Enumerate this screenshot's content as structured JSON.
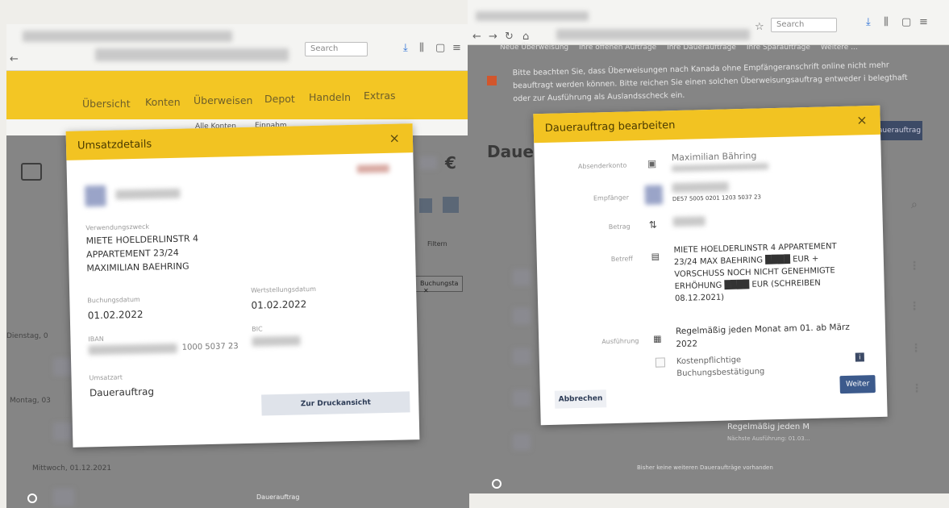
{
  "left": {
    "browser": {
      "search_placeholder": "Search"
    },
    "nav_items": [
      "Übersicht",
      "Konten",
      "Überweisen",
      "Depot",
      "Handeln",
      "Extras"
    ],
    "sub_nav": [
      "Alle Konten",
      "Einnahm"
    ],
    "euro_sign": "€",
    "row_labels": [
      "Dienstag, 0",
      "Montag, 03",
      "Mittwoch, 01.12.2021"
    ],
    "filter_tag": "Buchungsta",
    "filter_close": "✕",
    "umsatz_filter": "Filtern",
    "bottom_text": "Dauerauftrag",
    "modal": {
      "title": "Umsatzdetails",
      "close": "×",
      "verwendungszweck_label": "Verwendungszweck",
      "verwendungszweck_lines": [
        "MIETE HOELDERLINSTR 4",
        "APPARTEMENT 23/24",
        "MAXIMILIAN BAEHRING"
      ],
      "buchungsdatum_label": "Buchungsdatum",
      "buchungsdatum": "01.02.2022",
      "wertstellung_label": "Wertstellungsdatum",
      "wertstellung": "01.02.2022",
      "iban_label": "IBAN",
      "iban_tail": "1000 5037 23",
      "bic_label": "BIC",
      "umsatzart_label": "Umsatzart",
      "umsatzart": "Dauerauftrag",
      "print_button": "Zur Druckansicht"
    }
  },
  "right": {
    "browser": {
      "search_placeholder": "Search"
    },
    "top_links": [
      "Neue Überweisung",
      "Ihre offenen Aufträge",
      "Ihre Daueraufträge",
      "Ihre Sparaufträge",
      "Weitere ..."
    ],
    "notice": "Bitte beachten Sie, dass Überweisungen nach Kanada ohne Empfängeranschrift online nicht mehr beauftragt werden können. Bitte reichen Sie einen solchen Überweisungsauftrag entweder i belegthaft oder zur Ausführung als Auslandsscheck ein.",
    "page_title_partial": "Daue",
    "right_button": "Dauerauftrag",
    "list_rows": [
      {
        "title": "Regelmäßig jeden M",
        "sub": "Nächste Ausführung: 01.03..."
      }
    ],
    "bottom_note": "Bisher keine weiteren Daueraufträge vorhanden",
    "modal": {
      "title": "Dauerauftrag bearbeiten",
      "close": "×",
      "absender_label": "Absenderkonto",
      "absender_name": "Maximilian Bähring",
      "empfaenger_label": "Empfänger",
      "empfaenger_iban": "DE57 5005 0201 1203 5037 23",
      "betrag_label": "Betrag",
      "betreff_label": "Betreff",
      "betreff_text": "MIETE HOELDERLINSTR 4 APPARTEMENT 23/24 MAX BAEHRING ████ EUR + VORSCHUSS NOCH NICHT GENEHMIGTE ERHÖHUNG ████ EUR (SCHREIBEN 08.12.2021)",
      "ausfuehrung_label": "Ausführung",
      "ausfuehrung_text": "Regelmäßig jeden Monat am 01. ab März 2022",
      "kosten_label": "Kostenpflichtige Buchungsbestätigung",
      "info_icon": "i",
      "cancel_button": "Abbrechen",
      "next_button": "Weiter"
    }
  }
}
